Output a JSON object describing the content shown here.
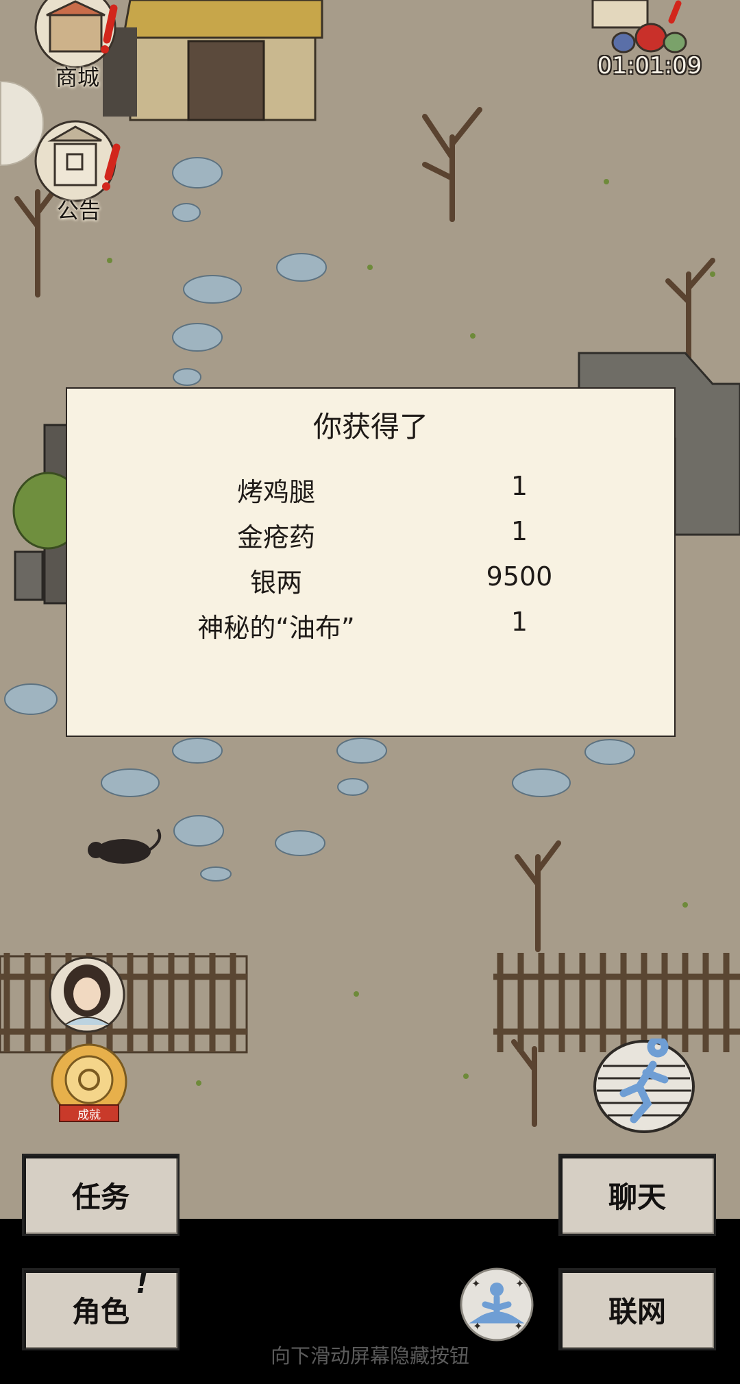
{
  "hud": {
    "shop_label": "商城",
    "notice_label": "公告",
    "timer": "01:01:09",
    "achievement_label": "成就"
  },
  "dialog": {
    "title": "你获得了",
    "items": [
      {
        "name": "烤鸡腿",
        "qty": "1"
      },
      {
        "name": "金疮药",
        "qty": "1"
      },
      {
        "name": "银两",
        "qty": "9500"
      },
      {
        "name": "神秘的“油布”",
        "qty": "1"
      }
    ]
  },
  "menu": {
    "task": "任务",
    "chat": "聊天",
    "role": "角色",
    "role_alert": "!",
    "network": "联网"
  },
  "hint": "向下滑动屏幕隐藏按钮",
  "icons": [
    "shop-icon",
    "notice-icon",
    "loot-bags-icon",
    "character-avatar-icon",
    "achievement-icon",
    "run-icon",
    "meditate-icon",
    "rat-icon"
  ],
  "colors": {
    "ground": "#a79c8a",
    "dialog_bg": "#f8f2e2",
    "button_bg": "#d6cfc4",
    "bar_bg": "#000000",
    "alert_red": "#d2261c"
  }
}
